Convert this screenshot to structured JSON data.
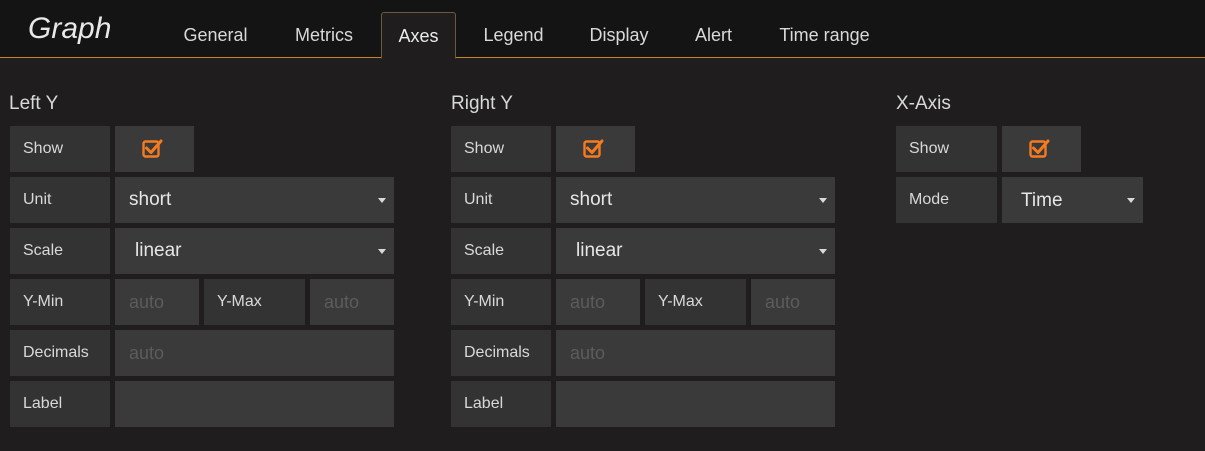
{
  "app": {
    "title": "Graph"
  },
  "tabs": [
    {
      "label": "General"
    },
    {
      "label": "Metrics"
    },
    {
      "label": "Axes",
      "active": true
    },
    {
      "label": "Legend"
    },
    {
      "label": "Display"
    },
    {
      "label": "Alert"
    },
    {
      "label": "Time range"
    }
  ],
  "colors": {
    "accent": "#f47b20",
    "tab_underline": "#c8841d"
  },
  "left_y": {
    "title": "Left Y",
    "show_label": "Show",
    "show_checked": true,
    "unit_label": "Unit",
    "unit_value": "short",
    "scale_label": "Scale",
    "scale_value": "linear",
    "ymin_label": "Y-Min",
    "ymin_placeholder": "auto",
    "ymax_label": "Y-Max",
    "ymax_placeholder": "auto",
    "decimals_label": "Decimals",
    "decimals_placeholder": "auto",
    "label_label": "Label",
    "label_value": ""
  },
  "right_y": {
    "title": "Right Y",
    "show_label": "Show",
    "show_checked": true,
    "unit_label": "Unit",
    "unit_value": "short",
    "scale_label": "Scale",
    "scale_value": "linear",
    "ymin_label": "Y-Min",
    "ymin_placeholder": "auto",
    "ymax_label": "Y-Max",
    "ymax_placeholder": "auto",
    "decimals_label": "Decimals",
    "decimals_placeholder": "auto",
    "label_label": "Label",
    "label_value": ""
  },
  "x_axis": {
    "title": "X-Axis",
    "show_label": "Show",
    "show_checked": true,
    "mode_label": "Mode",
    "mode_value": "Time"
  }
}
